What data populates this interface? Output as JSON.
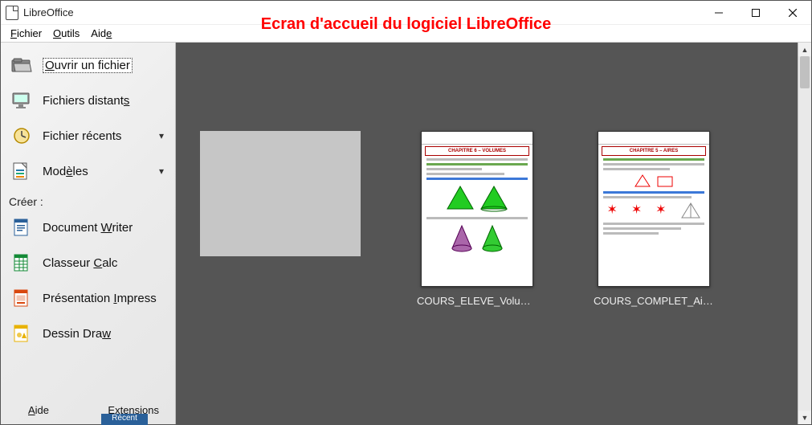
{
  "window": {
    "title": "LibreOffice",
    "overlay_caption": "Ecran d'accueil du logiciel LibreOffice"
  },
  "menubar": {
    "items": [
      {
        "label_pre": "",
        "key": "F",
        "label_post": "ichier"
      },
      {
        "label_pre": "",
        "key": "O",
        "label_post": "utils"
      },
      {
        "label_pre": "Aid",
        "key": "e",
        "label_post": ""
      }
    ]
  },
  "sidebar": {
    "actions": [
      {
        "label_pre": "",
        "key": "O",
        "label_post": "uvrir un fichier",
        "icon": "open"
      },
      {
        "label_pre": "Fichiers distant",
        "key": "s",
        "label_post": "",
        "icon": "remote"
      },
      {
        "label_pre": "Fichier récents",
        "key": "",
        "label_post": "",
        "icon": "clock"
      },
      {
        "label_pre": "Mod",
        "key": "è",
        "label_post": "les",
        "icon": "templates",
        "chevron": true
      }
    ],
    "section_label": "Créer :",
    "create": [
      {
        "label_pre": "Document ",
        "key": "W",
        "label_post": "riter",
        "icon": "writer"
      },
      {
        "label_pre": "Classeur ",
        "key": "C",
        "label_post": "alc",
        "icon": "calc"
      },
      {
        "label_pre": "Présentation ",
        "key": "I",
        "label_post": "mpress",
        "icon": "impress"
      },
      {
        "label_pre": "Dessin Dra",
        "key": "w",
        "label_post": "",
        "icon": "draw"
      }
    ],
    "bottom": {
      "help_pre": "",
      "help_key": "A",
      "help_post": "ide",
      "ext_pre": "E",
      "ext_key": "x",
      "ext_post": "tensions"
    }
  },
  "canvas": {
    "recent": [
      {
        "label": "COURS_ELEVE_Volumes...",
        "doc_title": "CHAPITRE 6 – VOLUMES",
        "kind": "volumes"
      },
      {
        "label": "COURS_COMPLET_Aires...",
        "doc_title": "CHAPITRE 5 – AIRES",
        "kind": "aires"
      }
    ]
  },
  "footer": {
    "blue_tab": "Récent"
  }
}
